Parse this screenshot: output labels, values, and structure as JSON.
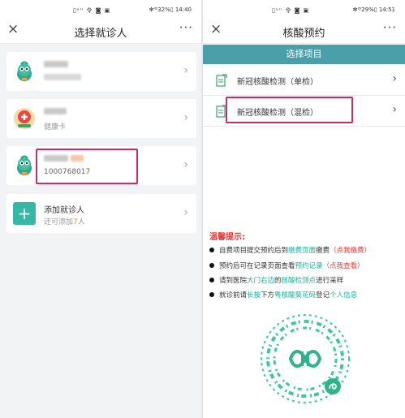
{
  "left": {
    "status": {
      "signal": "▯ᵃᴵᴵ 令 ◙ ▣",
      "right": "✻ᴵᴰ32%▯ 14:40"
    },
    "nav": {
      "close": "×",
      "title": "选择就诊人",
      "more": "···"
    },
    "patients": [
      {
        "sub": ""
      },
      {
        "sub": "健康卡"
      },
      {
        "sub": "1000768017"
      }
    ],
    "add": {
      "title": "添加就诊人",
      "sub_prefix": "还可添加",
      "sub_count": "7",
      "sub_suffix": "人"
    }
  },
  "right": {
    "status": {
      "signal": "▯ᵃᴵᴵ 令 ◙ ▣",
      "right": "✻ᴵᴰ29%▯ 14:51"
    },
    "nav": {
      "close": "×",
      "title": "核酸预约",
      "more": "···"
    },
    "section_title": "选择项目",
    "items": [
      {
        "label": "新冠核酸检测（单检）"
      },
      {
        "label": "新冠核酸检测（混检）"
      }
    ],
    "tips": {
      "title": "温馨提示:",
      "lines": [
        {
          "a": "自费项目提交预约后到",
          "b": "缴费页面",
          "c": "缴费",
          "d": "（点我缴费）"
        },
        {
          "a": "预约后可在记录页面查看",
          "b": "预约记录",
          "d": "（点我查看）"
        },
        {
          "a": "请到医院",
          "b": "大门右边",
          "c": "的",
          "e": "核酸检测点",
          "f": "进行采样"
        },
        {
          "a": "就诊前请",
          "b": "长按",
          "c": "下方",
          "e": "粤核酸葵花码",
          "f": "登记",
          "g": "个人信息"
        }
      ]
    }
  },
  "colors": {
    "teal_header": "#4a9fa8",
    "highlight": "#cc2b6a",
    "tip_red": "#e03d3d",
    "tip_green": "#18b3a0",
    "add_button": "#35b8a5"
  }
}
